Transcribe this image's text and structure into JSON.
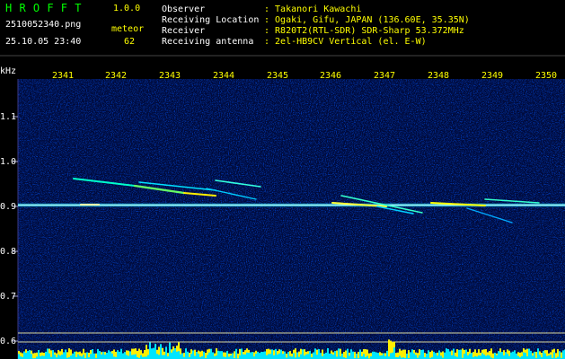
{
  "header": {
    "title": "H R O F F T",
    "version": "1.0.0",
    "filename": "2510052340.png",
    "type": "meteor",
    "datetime": "25.10.05 23:40",
    "count": "62"
  },
  "info": {
    "observer": {
      "label": "Observer",
      "value": ": Takanori Kawachi"
    },
    "location": {
      "label": "Receiving Location",
      "value": ": Ogaki, Gifu, JAPAN (136.60E, 35.35N)"
    },
    "receiver": {
      "label": "Receiver",
      "value": ": R820T2(RTL-SDR) SDR-Sharp 53.372MHz"
    },
    "antenna": {
      "label": "Receiving antenna",
      "value": ": 2el-HB9CV Vertical (el. E-W)"
    }
  },
  "axes": {
    "y_unit": "kHz",
    "y_ticks": [
      "1.1",
      "1.0",
      "0.9",
      "0.8",
      "0.7",
      "0.6"
    ],
    "x_ticks": [
      "2341",
      "2342",
      "2343",
      "2344",
      "2345",
      "2346",
      "2347",
      "2348",
      "2349",
      "2350"
    ]
  },
  "colors": {
    "title": "#00ff00",
    "version": "#ffff00",
    "text": "#ffffff",
    "value": "#ffff00",
    "axis_label": "#ffff00",
    "y_label": "#ffffff"
  }
}
